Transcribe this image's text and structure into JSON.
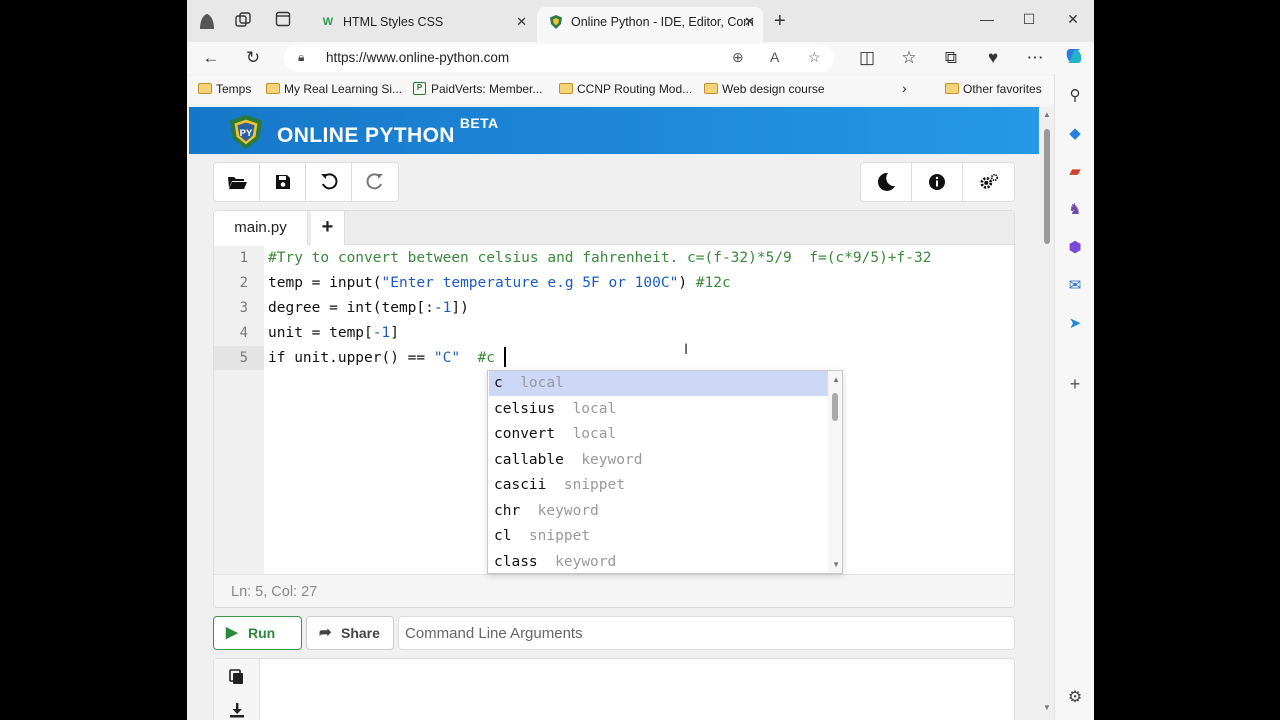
{
  "browser": {
    "tabs": [
      {
        "title": "HTML Styles CSS",
        "favicon": "W"
      },
      {
        "title": "Online Python - IDE, Editor, Com",
        "favicon": "PY",
        "active": true
      }
    ],
    "url": "https://www.online-python.com",
    "favorites": [
      {
        "label": "Temps",
        "icon": "folder-icon"
      },
      {
        "label": "My Real Learning Si...",
        "icon": "folder-icon"
      },
      {
        "label": "PaidVerts: Member...",
        "icon": "paidverts-icon"
      },
      {
        "label": "CCNP Routing Mod...",
        "icon": "folder-icon"
      },
      {
        "label": "Web design course",
        "icon": "folder-icon"
      },
      {
        "label": "Other favorites",
        "icon": "folder-icon"
      }
    ]
  },
  "app": {
    "brand": "ONLINE PYTHON",
    "badge": "BETA",
    "file_tab": "main.py",
    "add_tab": "+",
    "status": "Ln: 5,  Col: 27",
    "run_label": "Run",
    "share_label": "Share",
    "cmd_placeholder": "Command Line Arguments"
  },
  "editor": {
    "line_numbers": [
      "1",
      "2",
      "3",
      "4",
      "5"
    ],
    "lines": [
      {
        "p1": "#Try to convert between celsius and fahrenheit. c=(f-32)*5/9  f=(c*9/5)+f-32"
      },
      {
        "p1": "temp = input(",
        "p2": "\"Enter temperature e.g 5F or 100C\"",
        "p3": ") ",
        "p4": "#12c"
      },
      {
        "p1": "degree = int(temp[:",
        "p2": "-1",
        "p3": "])"
      },
      {
        "p1": "unit = temp[",
        "p2": "-1",
        "p3": "]"
      },
      {
        "p1": "if unit.upper() == ",
        "p2": "\"C\"",
        "p3": "  ",
        "p4": "#c"
      }
    ]
  },
  "autocomplete": [
    {
      "name": "c",
      "kind": "local",
      "selected": true
    },
    {
      "name": "celsius",
      "kind": "local"
    },
    {
      "name": "convert",
      "kind": "local"
    },
    {
      "name": "callable",
      "kind": "keyword"
    },
    {
      "name": "cascii",
      "kind": "snippet"
    },
    {
      "name": "chr",
      "kind": "keyword"
    },
    {
      "name": "cl",
      "kind": "snippet"
    },
    {
      "name": "class",
      "kind": "keyword"
    }
  ],
  "colors": {
    "banner": "#1f88d8",
    "run_green": "#2c8a3c",
    "comment_green": "#3a8a3a",
    "string_blue": "#1a5cc8",
    "ac_selected": "#cdd8f6"
  }
}
